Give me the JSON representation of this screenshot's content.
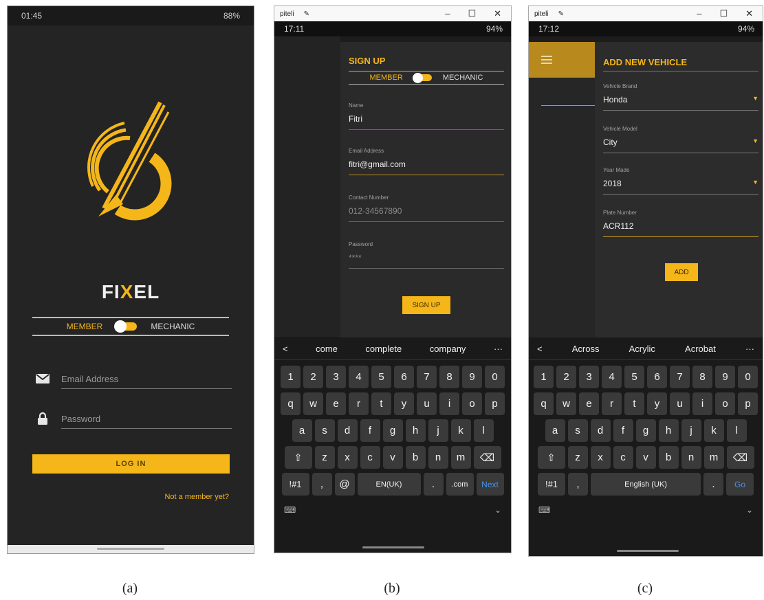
{
  "screen_a": {
    "status": {
      "time": "01:45",
      "right": "88%"
    },
    "brand": {
      "fi": "FI",
      "x": "X",
      "el": "EL"
    },
    "role_toggle": {
      "member": "MEMBER",
      "mechanic": "MECHANIC"
    },
    "email_placeholder": "Email Address",
    "password_placeholder": "Password",
    "login_label": "LOG IN",
    "signup_link": "Not a member yet?"
  },
  "screen_b": {
    "window": {
      "app": "piteli",
      "min": "–",
      "max": "☐",
      "close": "✕"
    },
    "status": {
      "time": "17:11",
      "right": "94%"
    },
    "title": "SIGN UP",
    "role_toggle": {
      "member": "MEMBER",
      "mechanic": "MECHANIC"
    },
    "fields": [
      {
        "label": "Name",
        "value": "Fitri"
      },
      {
        "label": "Email Address",
        "value": "fitri@gmail.com"
      },
      {
        "label": "Contact Number",
        "value": "012-34567890"
      },
      {
        "label": "Password",
        "value": "****"
      }
    ],
    "signup_label": "SIGN UP",
    "keyboard": {
      "back": "<",
      "suggestions": [
        "come",
        "complete",
        "company"
      ],
      "more": "···",
      "row1": [
        "1",
        "2",
        "3",
        "4",
        "5",
        "6",
        "7",
        "8",
        "9",
        "0"
      ],
      "row2": [
        "q",
        "w",
        "e",
        "r",
        "t",
        "y",
        "u",
        "i",
        "o",
        "p"
      ],
      "row3": [
        "a",
        "s",
        "d",
        "f",
        "g",
        "h",
        "j",
        "k",
        "l"
      ],
      "row4": [
        "z",
        "x",
        "c",
        "v",
        "b",
        "n",
        "m"
      ],
      "shift": "⇧",
      "backspace": "⌫",
      "sym": "!#1",
      "comma": ",",
      "at": "@",
      "space": "EN(UK)",
      "period": ".",
      "com": ".com",
      "action": "Next",
      "kb_icon": "⌨",
      "collapse": "⌄"
    }
  },
  "screen_c": {
    "window": {
      "app": "piteli",
      "min": "–",
      "max": "☐",
      "close": "✕"
    },
    "status": {
      "time": "17:12",
      "right": "94%"
    },
    "title": "ADD NEW VEHICLE",
    "fields": [
      {
        "label": "Vehicle Brand",
        "value": "Honda"
      },
      {
        "label": "Vehicle Model",
        "value": "City"
      },
      {
        "label": "Year Made",
        "value": "2018"
      },
      {
        "label": "Plate Number",
        "value": "ACR112"
      }
    ],
    "add_label": "ADD",
    "keyboard": {
      "back": "<",
      "suggestions": [
        "Across",
        "Acrylic",
        "Acrobat"
      ],
      "more": "···",
      "row1": [
        "1",
        "2",
        "3",
        "4",
        "5",
        "6",
        "7",
        "8",
        "9",
        "0"
      ],
      "row2": [
        "q",
        "w",
        "e",
        "r",
        "t",
        "y",
        "u",
        "i",
        "o",
        "p"
      ],
      "row3": [
        "a",
        "s",
        "d",
        "f",
        "g",
        "h",
        "j",
        "k",
        "l"
      ],
      "row4": [
        "z",
        "x",
        "c",
        "v",
        "b",
        "n",
        "m"
      ],
      "shift": "⇧",
      "backspace": "⌫",
      "sym": "!#1",
      "comma": ",",
      "space": "English (UK)",
      "period": ".",
      "action": "Go",
      "kb_icon": "⌨",
      "collapse": "⌄"
    }
  },
  "captions": [
    "(a)",
    "(b)",
    "(c)"
  ],
  "colors": {
    "accent": "#f5b619",
    "background": "#242424",
    "link_blue": "#4a90e2"
  }
}
